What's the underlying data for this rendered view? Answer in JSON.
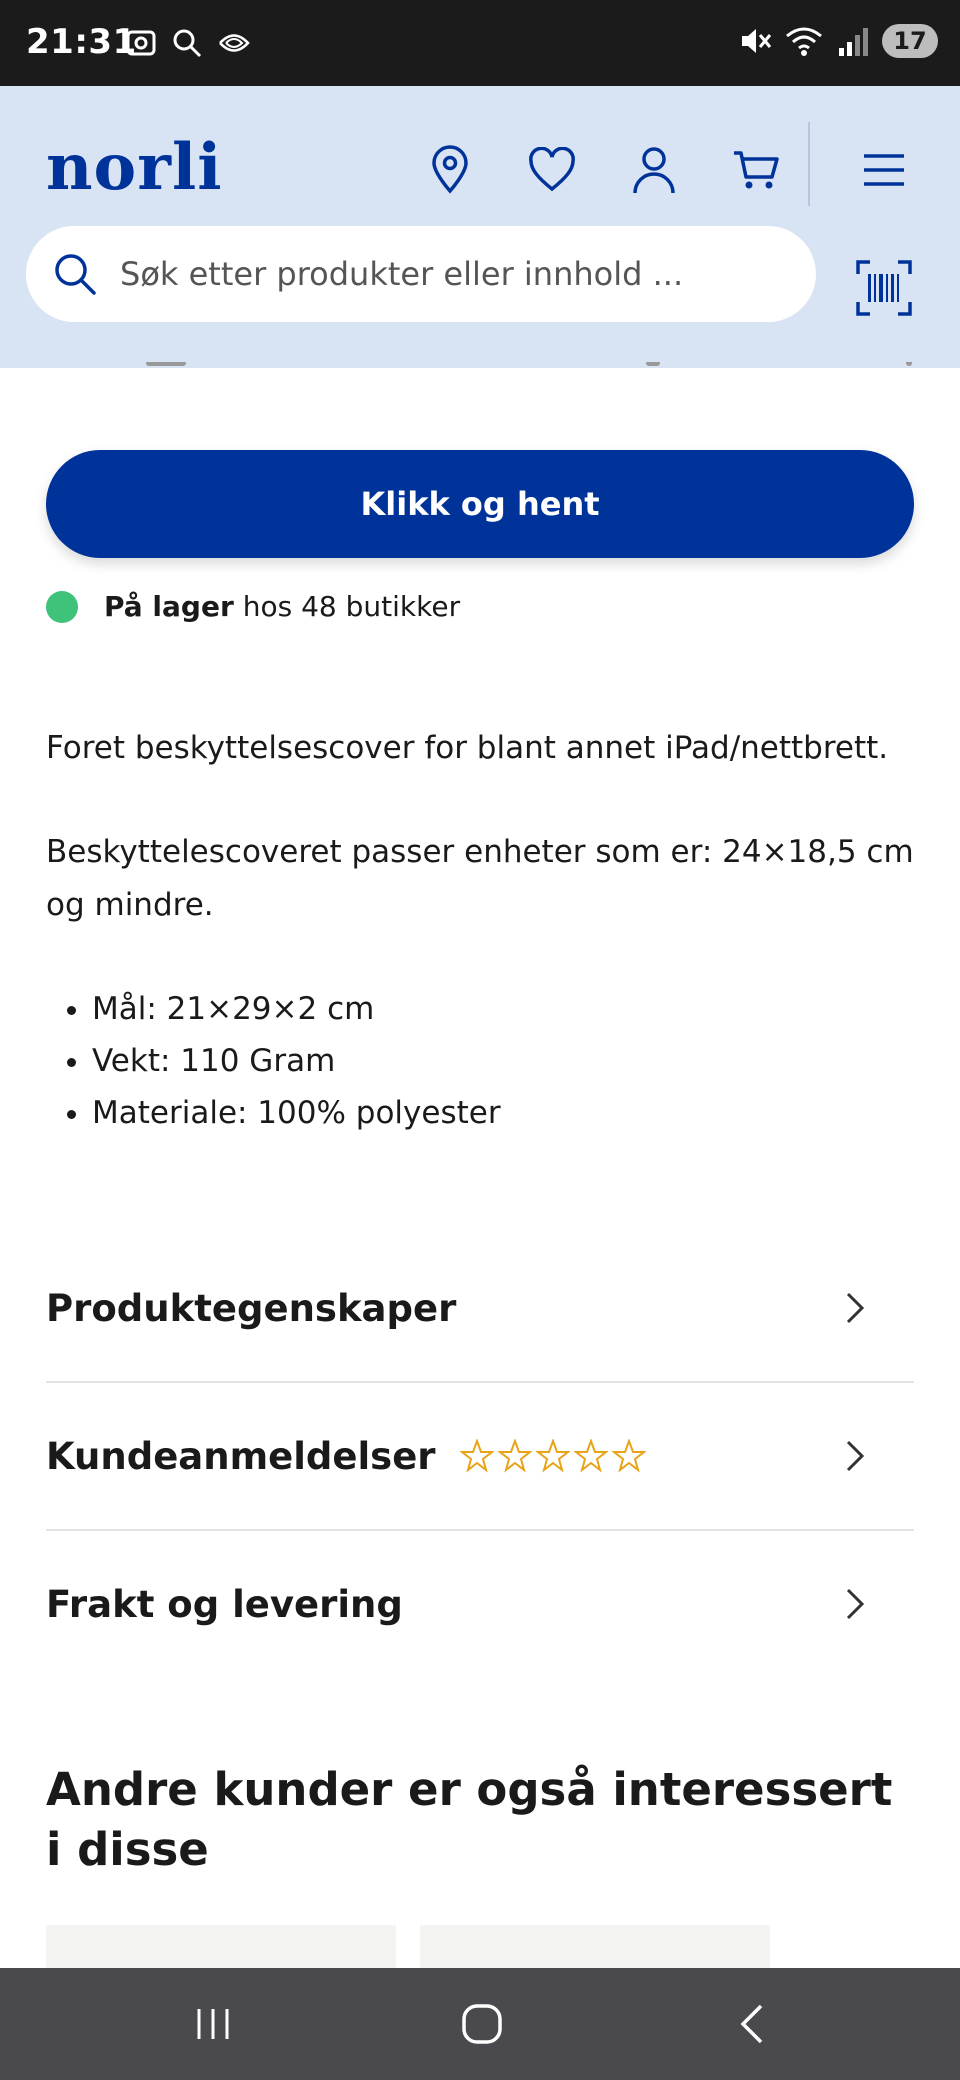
{
  "status_bar": {
    "time": "21:31",
    "battery": "17"
  },
  "header": {
    "logo": "norli",
    "search_placeholder": "Søk etter produkter eller innhold ...",
    "brand_color": "#003399",
    "icons": [
      "location-icon",
      "heart-icon",
      "user-icon",
      "cart-icon",
      "menu-icon",
      "barcode-scan-icon"
    ]
  },
  "cta": {
    "label": "Klikk og hent"
  },
  "stock": {
    "bold": "På lager",
    "rest": "hos 48 butikker",
    "color": "#3fc27a"
  },
  "description": {
    "para1": "Foret beskyttelsescover for blant annet iPad/nettbrett.",
    "para2": "Beskyttelescoveret passer enheter som er: 24×18,5 cm og mindre.",
    "specs": [
      "Mål: 21×29×2 cm",
      "Vekt: 110 Gram",
      "Materiale: 100% polyester"
    ]
  },
  "accordion": {
    "items": [
      {
        "label": "Produktegenskaper"
      },
      {
        "label": "Kundeanmeldelser",
        "rating": 0,
        "rating_max": 5
      },
      {
        "label": "Frakt og levering"
      }
    ],
    "star_color": "#e8a317"
  },
  "recommendations": {
    "title": "Andre kunder er også interessert i disse"
  }
}
